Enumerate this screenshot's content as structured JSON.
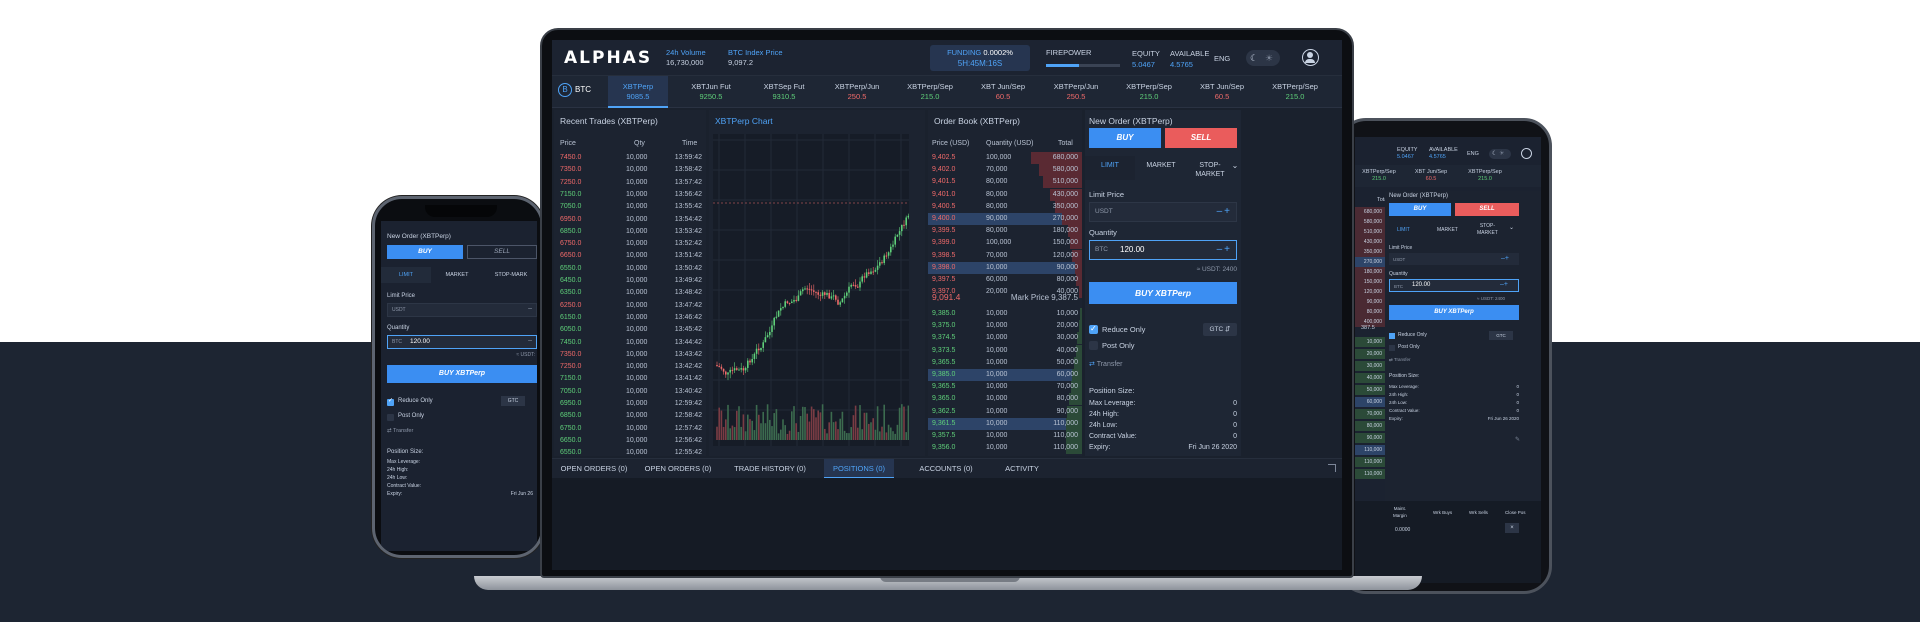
{
  "laptop": {
    "logo": "ALPHAS",
    "stats": [
      {
        "label": "24h Volume",
        "value": "16,730,000"
      },
      {
        "label": "BTC Index Price",
        "value": "9,097.2"
      }
    ],
    "funding": {
      "label": "FUNDING",
      "rate": "0.0002%",
      "countdown": "5H:45M:16S"
    },
    "firepower": {
      "label": "FIREPOWER",
      "level_percent": 45
    },
    "equity": {
      "label": "EQUITY",
      "value": "5.0467"
    },
    "available": {
      "label": "AVAILABLE",
      "value": "4.5765"
    },
    "language": "ENG",
    "theme_icons": {
      "dark": "☾",
      "light": "☀"
    },
    "instrument_selector": {
      "coin_symbol": "B",
      "label": "BTC"
    },
    "instruments": [
      {
        "name": "XBTPerp",
        "price": "9085.5",
        "color": "#4fa3f7",
        "active": true
      },
      {
        "name": "XBTJun Fut",
        "price": "9250.5",
        "color": "#5fd07a",
        "active": false
      },
      {
        "name": "XBTSep Fut",
        "price": "9310.5",
        "color": "#5fd07a",
        "active": false
      },
      {
        "name": "XBTPerp/Jun",
        "price": "250.5",
        "color": "#f06a6a",
        "active": false
      },
      {
        "name": "XBTPerp/Sep",
        "price": "215.0",
        "color": "#5fd07a",
        "active": false
      },
      {
        "name": "XBT Jun/Sep",
        "price": "60.5",
        "color": "#f06a6a",
        "active": false
      },
      {
        "name": "XBTPerp/Jun",
        "price": "250.5",
        "color": "#f06a6a",
        "active": false
      },
      {
        "name": "XBTPerp/Sep",
        "price": "215.0",
        "color": "#5fd07a",
        "active": false
      },
      {
        "name": "XBT Jun/Sep",
        "price": "60.5",
        "color": "#f06a6a",
        "active": false
      },
      {
        "name": "XBTPerp/Sep",
        "price": "215.0",
        "color": "#5fd07a",
        "active": false
      }
    ],
    "recent_trades": {
      "title": "Recent Trades (XBTPerp)",
      "columns": [
        "Price",
        "Qty",
        "Time"
      ],
      "rows": [
        {
          "price": "7450.0",
          "qty": "10,000",
          "time": "13:59:42",
          "side": "sell"
        },
        {
          "price": "7350.0",
          "qty": "10,000",
          "time": "13:58:42",
          "side": "sell"
        },
        {
          "price": "7250.0",
          "qty": "10,000",
          "time": "13:57:42",
          "side": "sell"
        },
        {
          "price": "7150.0",
          "qty": "10,000",
          "time": "13:56:42",
          "side": "buy"
        },
        {
          "price": "7050.0",
          "qty": "10,000",
          "time": "13:55:42",
          "side": "buy"
        },
        {
          "price": "6950.0",
          "qty": "10,000",
          "time": "13:54:42",
          "side": "sell"
        },
        {
          "price": "6850.0",
          "qty": "10,000",
          "time": "13:53:42",
          "side": "buy"
        },
        {
          "price": "6750.0",
          "qty": "10,000",
          "time": "13:52:42",
          "side": "sell"
        },
        {
          "price": "6650.0",
          "qty": "10,000",
          "time": "13:51:42",
          "side": "sell"
        },
        {
          "price": "6550.0",
          "qty": "10,000",
          "time": "13:50:42",
          "side": "buy"
        },
        {
          "price": "6450.0",
          "qty": "10,000",
          "time": "13:49:42",
          "side": "buy"
        },
        {
          "price": "6350.0",
          "qty": "10,000",
          "time": "13:48:42",
          "side": "buy"
        },
        {
          "price": "6250.0",
          "qty": "10,000",
          "time": "13:47:42",
          "side": "sell"
        },
        {
          "price": "6150.0",
          "qty": "10,000",
          "time": "13:46:42",
          "side": "buy"
        },
        {
          "price": "6050.0",
          "qty": "10,000",
          "time": "13:45:42",
          "side": "buy"
        },
        {
          "price": "7450.0",
          "qty": "10,000",
          "time": "13:44:42",
          "side": "buy"
        },
        {
          "price": "7350.0",
          "qty": "10,000",
          "time": "13:43:42",
          "side": "sell"
        },
        {
          "price": "7250.0",
          "qty": "10,000",
          "time": "13:42:42",
          "side": "sell"
        },
        {
          "price": "7150.0",
          "qty": "10,000",
          "time": "13:41:42",
          "side": "buy"
        },
        {
          "price": "7050.0",
          "qty": "10,000",
          "time": "13:40:42",
          "side": "buy"
        },
        {
          "price": "6950.0",
          "qty": "10,000",
          "time": "12:59:42",
          "side": "buy"
        },
        {
          "price": "6850.0",
          "qty": "10,000",
          "time": "12:58:42",
          "side": "buy"
        },
        {
          "price": "6750.0",
          "qty": "10,000",
          "time": "12:57:42",
          "side": "buy"
        },
        {
          "price": "6650.0",
          "qty": "10,000",
          "time": "12:56:42",
          "side": "buy"
        },
        {
          "price": "6550.0",
          "qty": "10,000",
          "time": "12:55:42",
          "side": "buy"
        },
        {
          "price": "7350.0",
          "qty": "10,000",
          "time": "12:57:42",
          "side": "sell"
        }
      ]
    },
    "chart": {
      "title": "XBTPerp Chart"
    },
    "order_book": {
      "title": "Order Book (XBTPerp)",
      "columns": [
        "Price (USD)",
        "Quantity (USD)",
        "Total"
      ],
      "asks": [
        {
          "price": "9,402.5",
          "qty": "100,000",
          "total": "680,000",
          "depth": 0.95,
          "hl": false
        },
        {
          "price": "9,402.0",
          "qty": "70,000",
          "total": "580,000",
          "depth": 0.8,
          "hl": false
        },
        {
          "price": "9,401.5",
          "qty": "80,000",
          "total": "510,000",
          "depth": 0.72,
          "hl": false
        },
        {
          "price": "9,401.0",
          "qty": "80,000",
          "total": "430,000",
          "depth": 0.6,
          "hl": false
        },
        {
          "price": "9,400.5",
          "qty": "80,000",
          "total": "350,000",
          "depth": 0.5,
          "hl": false
        },
        {
          "price": "9,400.0",
          "qty": "90,000",
          "total": "270,000",
          "depth": 0.38,
          "hl": true
        },
        {
          "price": "9,399.5",
          "qty": "80,000",
          "total": "180,000",
          "depth": 0.26,
          "hl": false
        },
        {
          "price": "9,399.0",
          "qty": "100,000",
          "total": "150,000",
          "depth": 0.22,
          "hl": false
        },
        {
          "price": "9,398.5",
          "qty": "70,000",
          "total": "120,000",
          "depth": 0.18,
          "hl": false
        },
        {
          "price": "9,398.0",
          "qty": "10,000",
          "total": "90,000",
          "depth": 0.13,
          "hl": true
        },
        {
          "price": "9,397.5",
          "qty": "60,000",
          "total": "80,000",
          "depth": 0.11,
          "hl": false
        },
        {
          "price": "9,397.0",
          "qty": "20,000",
          "total": "40,000",
          "depth": 0.06,
          "hl": false
        }
      ],
      "last_price": "9,091.4",
      "mark_price": "Mark Price 9,387.5",
      "bids": [
        {
          "price": "9,385.0",
          "qty": "10,000",
          "total": "10,000",
          "depth": 0.03,
          "hl": false
        },
        {
          "price": "9,375.0",
          "qty": "10,000",
          "total": "20,000",
          "depth": 0.06,
          "hl": false
        },
        {
          "price": "9,374.5",
          "qty": "10,000",
          "total": "30,000",
          "depth": 0.09,
          "hl": false
        },
        {
          "price": "9,373.5",
          "qty": "10,000",
          "total": "40,000",
          "depth": 0.12,
          "hl": false
        },
        {
          "price": "9,365.5",
          "qty": "10,000",
          "total": "50,000",
          "depth": 0.15,
          "hl": false
        },
        {
          "price": "9,385.0",
          "qty": "10,000",
          "total": "60,000",
          "depth": 0.18,
          "hl": true
        },
        {
          "price": "9,365.5",
          "qty": "10,000",
          "total": "70,000",
          "depth": 0.21,
          "hl": false
        },
        {
          "price": "9,365.0",
          "qty": "10,000",
          "total": "80,000",
          "depth": 0.24,
          "hl": false
        },
        {
          "price": "9,362.5",
          "qty": "10,000",
          "total": "90,000",
          "depth": 0.27,
          "hl": false
        },
        {
          "price": "9,361.5",
          "qty": "10,000",
          "total": "110,000",
          "depth": 0.3,
          "hl": true
        },
        {
          "price": "9,357.5",
          "qty": "10,000",
          "total": "110,000",
          "depth": 0.3,
          "hl": false
        },
        {
          "price": "9,356.0",
          "qty": "10,000",
          "total": "110,000",
          "depth": 0.3,
          "hl": false
        }
      ]
    },
    "order_form": {
      "title": "New Order (XBTPerp)",
      "buy": "BUY",
      "sell": "SELL",
      "tabs": [
        "LIMIT",
        "MARKET",
        "STOP-\nMARKET"
      ],
      "limit_price_label": "Limit Price",
      "limit_currency": "USDT",
      "quantity_label": "Quantity",
      "qty_currency": "BTC",
      "qty_value": "120.00",
      "usdt_note": "≈ USDT: 2400",
      "submit": "BUY XBTPerp",
      "reduce_only": "Reduce Only",
      "post_only": "Post Only",
      "tif": "GTC",
      "transfer": "Transfer",
      "position_title": "Position Size:",
      "position": [
        {
          "label": "Max Leverage:",
          "value": "0"
        },
        {
          "label": "24h High:",
          "value": "0"
        },
        {
          "label": "24h Low:",
          "value": "0"
        },
        {
          "label": "Contract Value:",
          "value": "0"
        },
        {
          "label": "Expiry:",
          "value": "Fri Jun 26 2020"
        }
      ]
    },
    "bottom_tabs": [
      {
        "label": "OPEN ORDERS (0)",
        "active": false
      },
      {
        "label": "OPEN ORDERS (0)",
        "active": false
      },
      {
        "label": "TRADE HISTORY (0)",
        "active": false
      },
      {
        "label": "POSITIONS (0)",
        "active": true
      },
      {
        "label": "ACCOUNTS (0)",
        "active": false
      },
      {
        "label": "ACTIVITY",
        "active": false
      }
    ]
  },
  "phone": {
    "title": "New Order (XBTPerp)",
    "buy": "BUY",
    "sell": "SELL",
    "tabs": [
      "LIMIT",
      "MARKET",
      "STOP-MARK"
    ],
    "limit_price_label": "Limit Price",
    "limit_currency": "USDT",
    "quantity_label": "Quantity",
    "qty_currency": "BTC",
    "qty_value": "120.00",
    "usdt_note": "≈ USDT:",
    "submit": "BUY XBTPerp",
    "reduce_only": "Reduce Only",
    "post_only": "Post Only",
    "tif": "GTC",
    "transfer": "Transfer",
    "position_title": "Position Size:",
    "position": [
      {
        "label": "Max Leverage:",
        "value": ""
      },
      {
        "label": "24h High:",
        "value": ""
      },
      {
        "label": "24h Low:",
        "value": ""
      },
      {
        "label": "Contract Value:",
        "value": ""
      },
      {
        "label": "Expiry:",
        "value": "Fri Jun 26"
      }
    ]
  },
  "tablet": {
    "equity": {
      "label": "EQUITY",
      "value": "5.0467"
    },
    "available": {
      "label": "AVAILABLE",
      "value": "4.5765"
    },
    "language": "ENG",
    "instruments": [
      {
        "name": "XBTPerp/Sep",
        "price": "215.0"
      },
      {
        "name": "XBT Jun/Sep",
        "price": "60.5"
      },
      {
        "name": "XBTPerp/Sep",
        "price": "215.0"
      }
    ],
    "total_label": "Total",
    "totals": [
      "680,000",
      "580,000",
      "510,000",
      "430,000",
      "350,000",
      "270,000",
      "180,000",
      "150,000",
      "120,000",
      "90,000",
      "80,000",
      "400,000"
    ],
    "mark_fragment": "387.5",
    "bid_totals": [
      "10,000",
      "20,000",
      "30,000",
      "40,000",
      "50,000",
      "60,000",
      "70,000",
      "80,000",
      "90,000",
      "110,000",
      "110,000",
      "110,000"
    ],
    "title": "New Order (XBTPerp)",
    "buy": "BUY",
    "sell": "SELL",
    "tabs": [
      "LIMIT",
      "MARKET",
      "STOP-\nMARKET"
    ],
    "limit_price_label": "Limit Price",
    "limit_currency": "USDT",
    "quantity_label": "Quantity",
    "qty_currency": "BTC",
    "qty_value": "120.00",
    "usdt_note": "≈ USDT: 2400",
    "submit": "BUY XBTPerp",
    "reduce_only": "Reduce Only",
    "post_only": "Post Only",
    "tif": "GTC",
    "transfer": "Transfer",
    "position_title": "Position Size:",
    "position": [
      {
        "label": "Max Leverage:",
        "value": "0"
      },
      {
        "label": "24h High:",
        "value": "0"
      },
      {
        "label": "24h Low:",
        "value": "0"
      },
      {
        "label": "Contract Value:",
        "value": "0"
      },
      {
        "label": "Expiry:",
        "value": "Fri Jun 26 2020"
      }
    ],
    "table_headers": [
      "Maint.\nMargin",
      "Wrk Buys",
      "Wrk Sells",
      "Close Pos"
    ],
    "table_value": "0.0000"
  }
}
